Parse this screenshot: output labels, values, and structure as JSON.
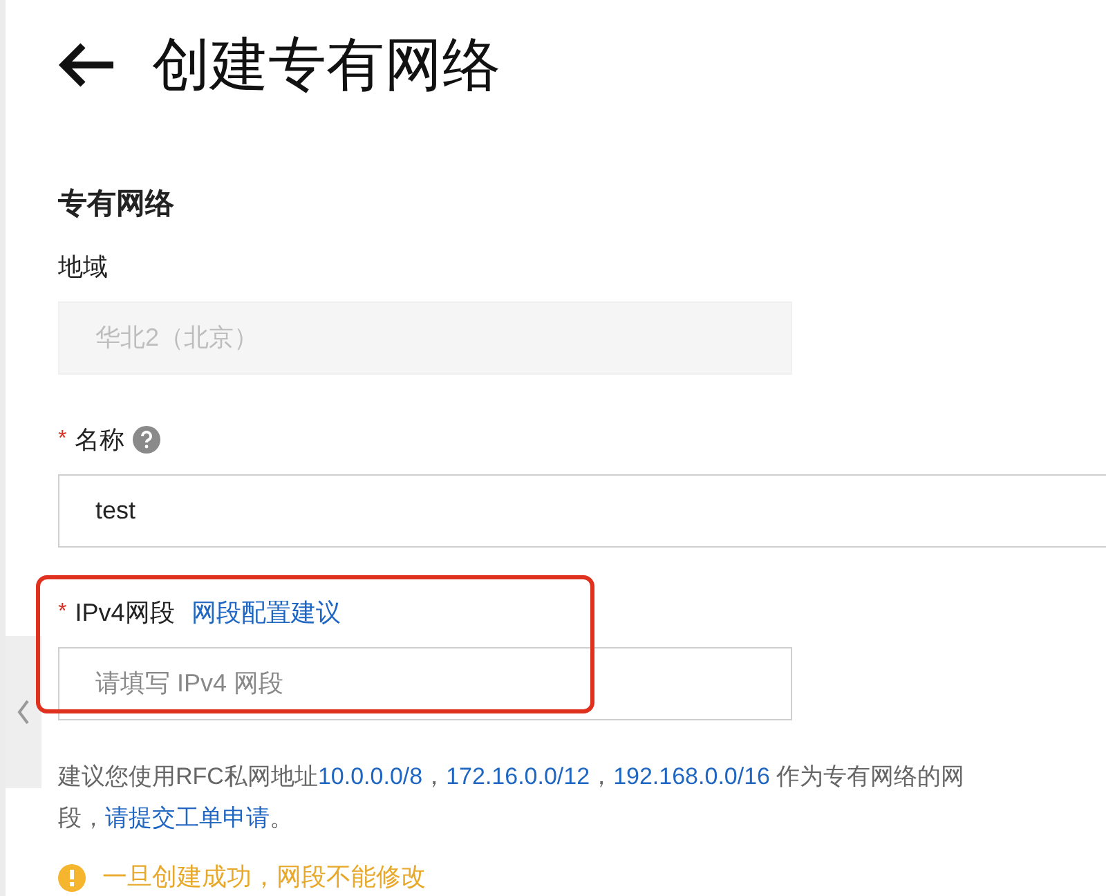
{
  "header": {
    "title": "创建专有网络"
  },
  "section": {
    "title": "专有网络"
  },
  "fields": [
    {
      "kind": "region",
      "label": "地域",
      "value": "华北2（北京）"
    },
    {
      "kind": "name",
      "label": "名称",
      "required_mark": "*",
      "help": true,
      "value": "test"
    },
    {
      "kind": "cidr",
      "label": "IPv4网段",
      "required_mark": "*",
      "link": "网段配置建议",
      "placeholder": "请填写 IPv4 网段",
      "highlighted": true
    }
  ],
  "hint": [
    {
      "kind": "text",
      "text": "建议您使用RFC私网地址"
    },
    {
      "kind": "link",
      "text": "10.0.0.0/8"
    },
    {
      "kind": "text",
      "text": "，"
    },
    {
      "kind": "link",
      "text": "172.16.0.0/12"
    },
    {
      "kind": "text",
      "text": "，"
    },
    {
      "kind": "link",
      "text": "192.168.0.0/16"
    },
    {
      "kind": "text",
      "text": " 作为专有网络的网段，"
    },
    {
      "kind": "link",
      "text": "请提交工单申请"
    },
    {
      "kind": "text",
      "text": "。"
    }
  ],
  "warning": "一旦创建成功，网段不能修改"
}
